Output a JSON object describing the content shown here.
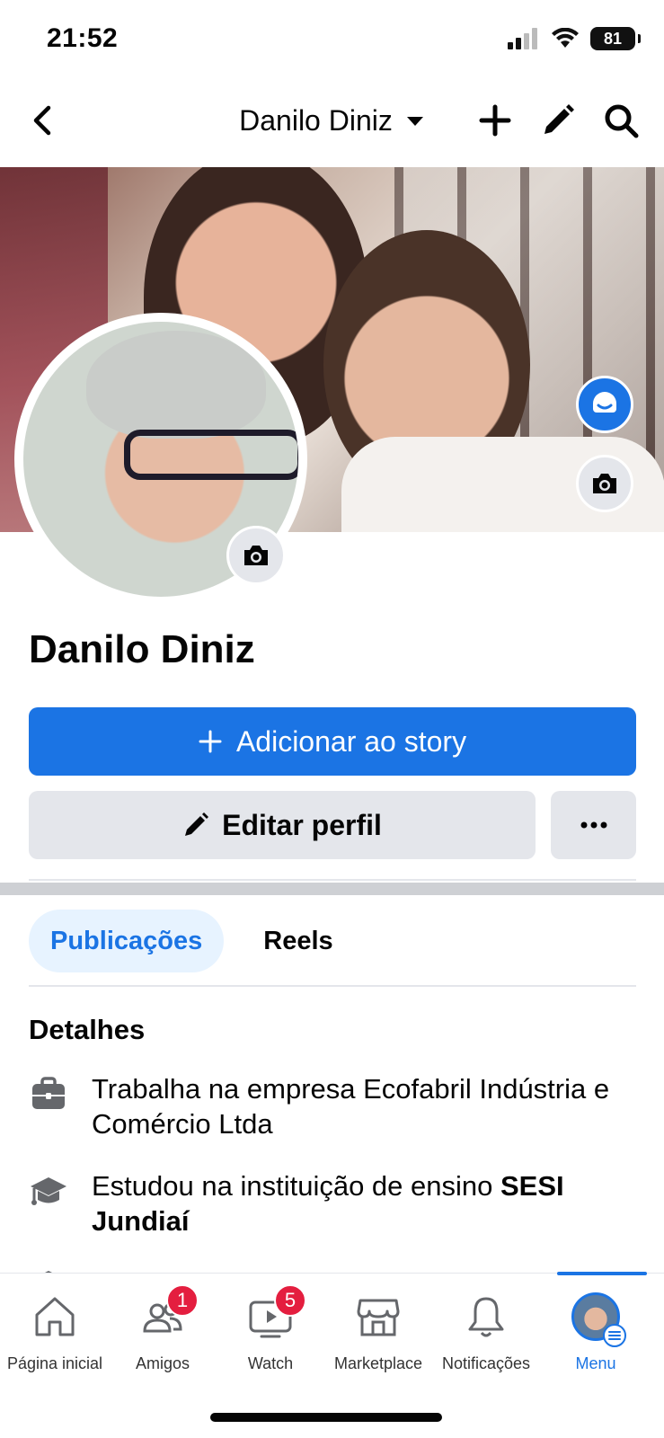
{
  "status": {
    "time": "21:52",
    "battery": "81"
  },
  "nav": {
    "title": "Danilo Diniz"
  },
  "profile": {
    "name": "Danilo Diniz"
  },
  "actions": {
    "add_story": "Adicionar ao story",
    "edit_profile": "Editar perfil"
  },
  "tabs": [
    {
      "label": "Publicações"
    },
    {
      "label": "Reels"
    }
  ],
  "details": {
    "title": "Detalhes",
    "work": "Trabalha na empresa Ecofabril Indústria e Comércio Ltda",
    "education_prefix": "Estudou na instituição de ensino ",
    "education_school": "SESI Jundiaí"
  },
  "bottom_nav": {
    "items": [
      {
        "label": "Página inicial"
      },
      {
        "label": "Amigos",
        "badge": "1"
      },
      {
        "label": "Watch",
        "badge": "5"
      },
      {
        "label": "Marketplace"
      },
      {
        "label": "Notificações"
      },
      {
        "label": "Menu"
      }
    ]
  },
  "colors": {
    "brand": "#1b74e4",
    "badge": "#e41e3f",
    "button_secondary": "#e4e6eb"
  }
}
